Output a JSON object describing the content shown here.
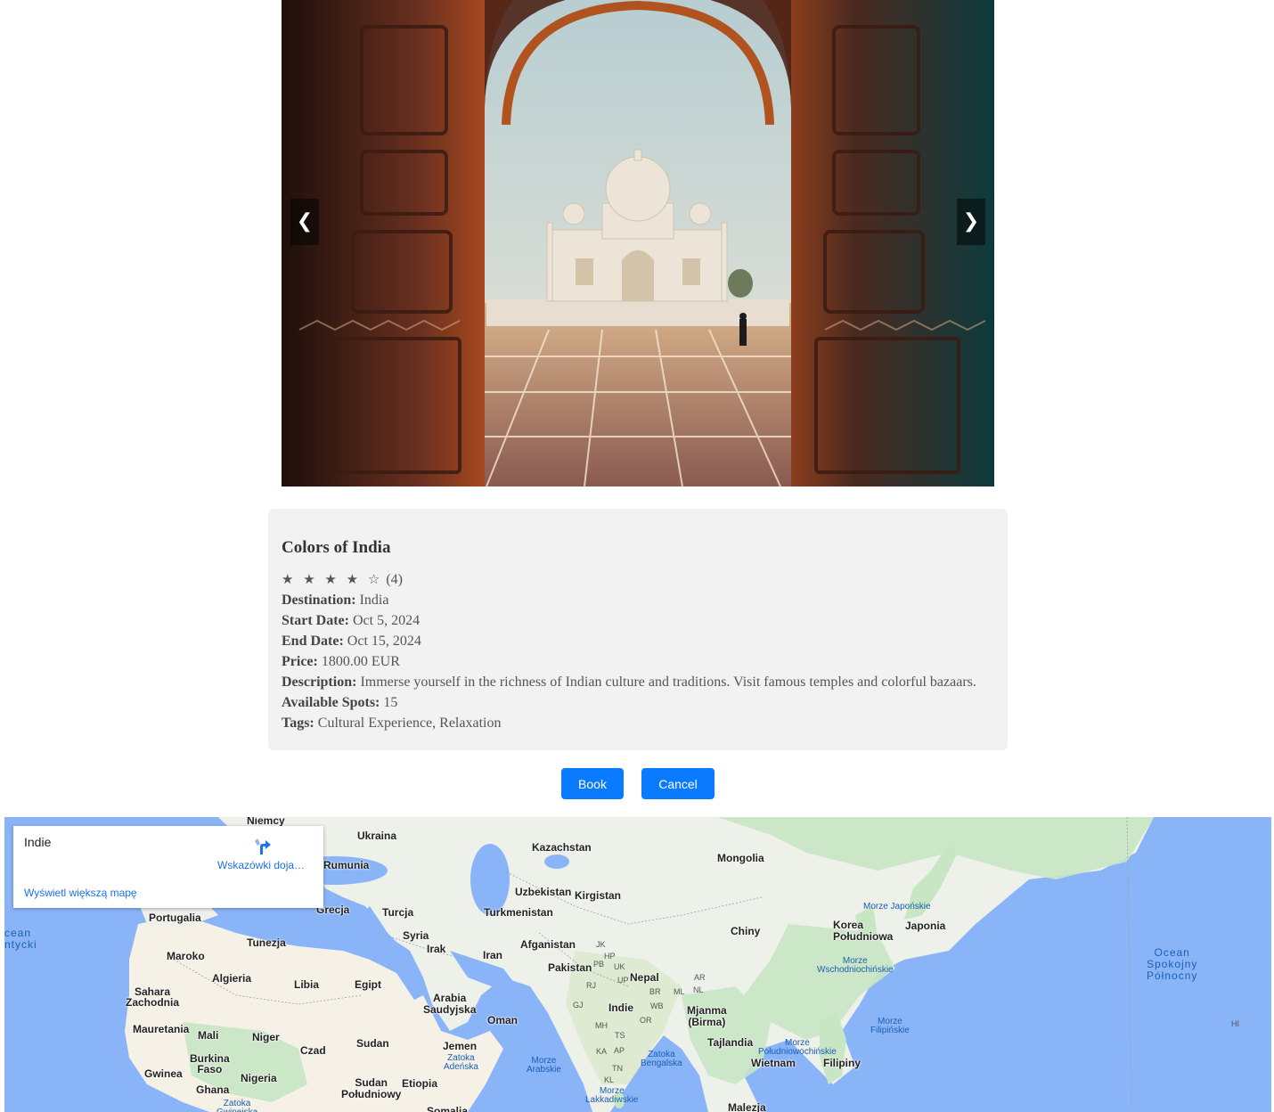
{
  "carousel": {
    "prev_label": "❮",
    "next_label": "❯"
  },
  "trip": {
    "title": "Colors of India",
    "rating_stars": "★ ★ ★ ★ ☆",
    "rating_value": "(4)",
    "rating": 4,
    "rating_max": 5,
    "details": [
      {
        "label": "Destination:",
        "value": "India"
      },
      {
        "label": "Start Date:",
        "value": "Oct 5, 2024"
      },
      {
        "label": "End Date:",
        "value": "Oct 15, 2024"
      },
      {
        "label": "Price:",
        "value": "1800.00 EUR"
      },
      {
        "label": "Description:",
        "value": "Immerse yourself in the richness of Indian culture and traditions. Visit famous temples and colorful bazaars."
      },
      {
        "label": "Available Spots:",
        "value": "15"
      },
      {
        "label": "Tags:",
        "value": "Cultural Experience, Relaxation"
      }
    ]
  },
  "actions": {
    "book_label": "Book",
    "cancel_label": "Cancel"
  },
  "map": {
    "info": {
      "place": "Indie",
      "directions_label": "Wskazówki doja…",
      "larger_map_label": "Wyświetl większą mapę"
    },
    "countries": {
      "niemcy": "Niemcy",
      "ukraina": "Ukraina",
      "kazachstan": "Kazachstan",
      "mongolia": "Mongolia",
      "rumunia": "Rumunia",
      "uzbekistan": "Uzbekistan",
      "kirgistan": "Kirgistan",
      "portugalia": "Portugalia",
      "grecja": "Grecja",
      "turcja": "Turcja",
      "turkmenistan": "Turkmenistan",
      "korea": "Korea\nPołudniowa",
      "japonia": "Japonia",
      "chiny": "Chiny",
      "tunezja": "Tunezja",
      "syria": "Syria",
      "irak": "Irak",
      "iran": "Iran",
      "afganistan": "Afganistan",
      "pakistan": "Pakistan",
      "nepal": "Nepal",
      "maroko": "Maroko",
      "algieria": "Algieria",
      "libia": "Libia",
      "egipt": "Egipt",
      "arabia": "Arabia\nSaudyjska",
      "oman": "Oman",
      "indie": "Indie",
      "mjanma": "Mjanma\n(Birma)",
      "sahara": "Sahara\nZachodnia",
      "mauretania": "Mauretania",
      "mali": "Mali",
      "niger": "Niger",
      "czad": "Czad",
      "sudan": "Sudan",
      "jemen": "Jemen",
      "tajlandia": "Tajlandia",
      "wietnam": "Wietnam",
      "filipiny": "Filipiny",
      "burkina": "Burkina\nFaso",
      "gwinea": "Gwinea",
      "ghana": "Ghana",
      "nigeria": "Nigeria",
      "sudan_pd": "Sudan\nPołudniowy",
      "etiopia": "Etiopia",
      "somalia": "Somalia",
      "malezja": "Malezja"
    },
    "seas": {
      "morze_japonskie": "Morze Japońskie",
      "morze_wsch": "Morze\nWschodniochińskie",
      "morze_filip": "Morze\nFilipińskie",
      "morze_pd": "Morze\nPołudniowochińskie",
      "zatoka_bengalska": "Zatoka\nBengalska",
      "morze_arabskie": "Morze\nArabskie",
      "zatoka_adenska": "Zatoka\nAdeńska",
      "morze_lakk": "Morze\nLakkadiwskie",
      "zatoka_gw": "Zatoka\nGwinejska"
    },
    "oceans": {
      "atlantic": "cean\nntycki",
      "pacific": "Ocean\nSpokojny\nPółnocny"
    },
    "states": {
      "jk": "JK",
      "pb": "PB",
      "hp": "HP",
      "uk": "UK",
      "rj": "RJ",
      "up": "UP",
      "br": "BR",
      "ml": "ML",
      "nl": "NL",
      "ar": "AR",
      "gj": "GJ",
      "mh": "MH",
      "or": "OR",
      "ts": "TS",
      "ka": "KA",
      "ap": "AP",
      "wb": "WB",
      "tn": "TN",
      "kl": "KL",
      "hi": "HI"
    },
    "colors": {
      "water": "#8ab4f8",
      "land": "#eef0ea",
      "forest": "#c8e6c3",
      "desert": "#f5f1e6"
    }
  }
}
